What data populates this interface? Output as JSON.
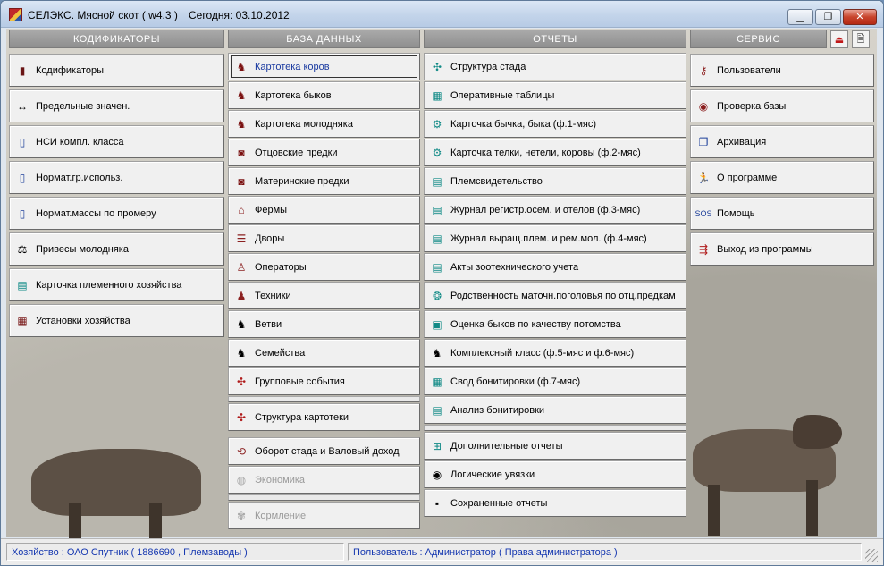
{
  "window": {
    "title": "СЕЛЭКС. Мясной скот ( w4.3 )",
    "today": "Сегодня: 03.10.2012",
    "controls": {
      "minimize": "▁",
      "maximize": "❐",
      "close": "✕"
    }
  },
  "sections": {
    "codifiers": {
      "header": "КОДИФИКАТОРЫ",
      "items": [
        {
          "label": "Кодификаторы",
          "icon": "bar-chart-icon"
        },
        {
          "label": "Предельные значен.",
          "icon": "range-arrows-icon"
        },
        {
          "label": "НСИ компл. класса",
          "icon": "book-icon"
        },
        {
          "label": "Нормат.гр.использ.",
          "icon": "book-icon"
        },
        {
          "label": "Нормат.массы по промеру",
          "icon": "book-icon"
        },
        {
          "label": "Привесы молодняка",
          "icon": "scales-icon"
        },
        {
          "label": "Карточка племенного хозяйства",
          "icon": "cards-icon"
        },
        {
          "label": "Установки хозяйства",
          "icon": "building-icon"
        }
      ]
    },
    "database": {
      "header": "БАЗА ДАННЫХ",
      "items": [
        {
          "label": "Картотека коров",
          "icon": "cow-icon"
        },
        {
          "label": "Картотека быков",
          "icon": "bull-icon"
        },
        {
          "label": "Картотека молодняка",
          "icon": "calf-icon"
        },
        {
          "label": "Отцовские предки",
          "icon": "sire-icon"
        },
        {
          "label": "Материнские предки",
          "icon": "dam-icon"
        },
        {
          "label": "Фермы",
          "icon": "farm-icon"
        },
        {
          "label": "Дворы",
          "icon": "yard-icon"
        },
        {
          "label": "Операторы",
          "icon": "operator-icon"
        },
        {
          "label": "Техники",
          "icon": "technician-icon"
        },
        {
          "label": "Ветви",
          "icon": "branch-icon"
        },
        {
          "label": "Семейства",
          "icon": "family-icon"
        },
        {
          "label": "Групповые события",
          "icon": "group-events-icon"
        },
        {
          "label": "Структура картотеки",
          "icon": "structure-icon"
        },
        {
          "label": "Оборот стада и Валовый доход",
          "icon": "turnover-icon"
        },
        {
          "label": "Экономика",
          "icon": "economy-icon"
        },
        {
          "label": "Кормление",
          "icon": "feeding-icon"
        }
      ]
    },
    "reports": {
      "header": "ОТЧЕТЫ",
      "items": [
        {
          "label": "Структура стада",
          "icon": "herd-structure-icon"
        },
        {
          "label": "Оперативные таблицы",
          "icon": "table-icon"
        },
        {
          "label": "Карточка бычка, быка (ф.1-мяс)",
          "icon": "gear-card-icon"
        },
        {
          "label": "Карточка телки, нетели, коровы (ф.2-мяс)",
          "icon": "gear-card-icon"
        },
        {
          "label": "Племсвидетельство",
          "icon": "certificate-icon"
        },
        {
          "label": "Журнал регистр.осем. и отелов (ф.3-мяс)",
          "icon": "journal-icon"
        },
        {
          "label": "Журнал выращ.плем. и рем.мол. (ф.4-мяс)",
          "icon": "journal-icon"
        },
        {
          "label": "Акты зоотехнического учета",
          "icon": "acts-icon"
        },
        {
          "label": "Родственность маточн.поголовья по отц.предкам",
          "icon": "kinship-icon"
        },
        {
          "label": "Оценка быков по качеству потомства",
          "icon": "evaluation-icon"
        },
        {
          "label": "Комплексный класс (ф.5-мяс и ф.6-мяс)",
          "icon": "complex-class-icon"
        },
        {
          "label": "Свод бонитировки (ф.7-мяс)",
          "icon": "grid-icon"
        },
        {
          "label": "Анализ бонитировки",
          "icon": "analysis-icon"
        },
        {
          "label": "Дополнительные отчеты",
          "icon": "add-reports-icon"
        },
        {
          "label": "Логические увязки",
          "icon": "links-icon"
        },
        {
          "label": "Сохраненные отчеты",
          "icon": "floppy-icon"
        }
      ]
    },
    "service": {
      "header": "СЕРВИС",
      "items": [
        {
          "label": "Пользователи",
          "icon": "key-icon"
        },
        {
          "label": "Проверка базы",
          "icon": "eye-icon"
        },
        {
          "label": "Архивация",
          "icon": "archive-icon"
        },
        {
          "label": "О программе",
          "icon": "runner-icon"
        },
        {
          "label": "Помощь",
          "icon": "sos-icon"
        },
        {
          "label": "Выход из программы",
          "icon": "exit-icon"
        }
      ]
    }
  },
  "status": {
    "farm": "Хозяйство : ОАО Спутник ( 1886690 , Племзаводы )",
    "user": "Пользователь : Администратор ( Права администратора )"
  }
}
